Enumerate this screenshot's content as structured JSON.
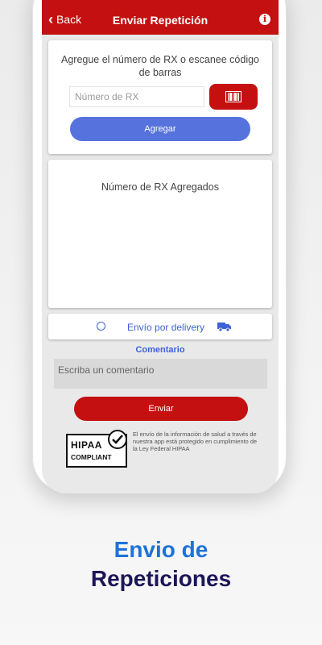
{
  "header": {
    "back_label": "Back",
    "title": "Enviar Repetición",
    "info_icon": "info-icon"
  },
  "add_card": {
    "instruction": "Agregue el número de RX o escanee código de barras",
    "rx_placeholder": "Número de RX",
    "scan_icon": "barcode-icon",
    "add_label": "Agregar"
  },
  "list_card": {
    "title": "Número de RX Agregados"
  },
  "delivery": {
    "label": "Envío por delivery",
    "selected": false,
    "icon": "truck-icon"
  },
  "comment": {
    "label": "Comentario",
    "placeholder": "Escriba un comentario"
  },
  "submit_label": "Enviar",
  "hipaa": {
    "badge_line1": "HIPAA",
    "badge_line2": "COMPLIANT",
    "notice": "El envío de la información de salud a través de nuestra app está protegido en cumplimiento de la Ley Federal HIPAA"
  },
  "tagline": {
    "line1": "Envio de",
    "line2": "Repeticiones"
  },
  "colors": {
    "primary_red": "#c41010",
    "accent_blue": "#5672dc",
    "link_blue": "#3d62d6",
    "tagline_blue": "#1e73d8",
    "tagline_navy": "#1b1657"
  }
}
